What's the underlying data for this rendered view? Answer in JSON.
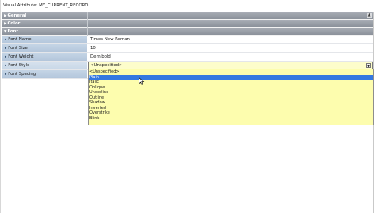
{
  "window": {
    "title": "Visual Attribute: MY_CURRENT_RECORD"
  },
  "categories": [
    {
      "label": "General",
      "expanded": false
    },
    {
      "label": "Color",
      "expanded": false
    },
    {
      "label": "Font",
      "expanded": true
    }
  ],
  "font_properties": [
    {
      "name": "Font Name",
      "value": "Times New Roman"
    },
    {
      "name": "Font Size",
      "value": "10"
    },
    {
      "name": "Font Weight",
      "value": "Demibold"
    },
    {
      "name": "Font Style",
      "value": "<Unspecified>"
    },
    {
      "name": "Font Spacing",
      "value": ""
    }
  ],
  "font_style_dropdown": {
    "options": [
      "<Unspecified>",
      "Plain",
      "Italic",
      "Oblique",
      "Underline",
      "Outline",
      "Shadow",
      "Inverted",
      "Overstrike",
      "Blink"
    ],
    "highlighted": "Plain"
  },
  "colors": {
    "category_bar": "#8b919a",
    "property_name_bg": "#b3c6db",
    "selected_value_bg": "#fdfdcb",
    "dropdown_bg": "#fdfdae",
    "highlight": "#3478e0"
  },
  "icons": {
    "expand": "triangle-right-icon",
    "collapse": "triangle-down-icon",
    "dropdown": "chevron-down-icon",
    "scroll": "scroll-up-icon"
  }
}
